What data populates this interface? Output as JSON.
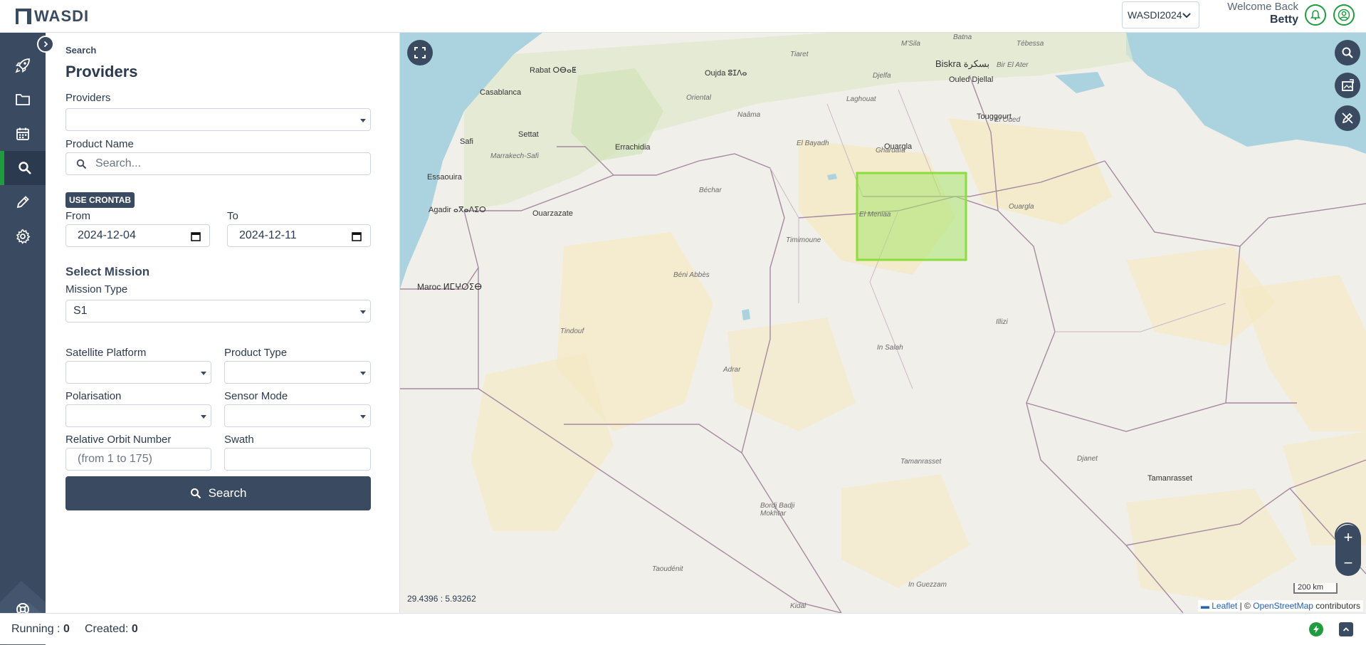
{
  "app": {
    "logo_text": "WASDI"
  },
  "header": {
    "workspace_label": "WASDI2024",
    "welcome_line": "Welcome Back",
    "user_name": "Betty"
  },
  "sidebar": {
    "items": [
      {
        "icon": "rocket-icon"
      },
      {
        "icon": "folder-icon"
      },
      {
        "icon": "calendar-icon"
      },
      {
        "icon": "search-icon",
        "active": true
      },
      {
        "icon": "pencil-icon"
      },
      {
        "icon": "gear-icon"
      }
    ],
    "help_icon": "lifebuoy-icon"
  },
  "form": {
    "breadcrumb": "Search",
    "title": "Providers",
    "providers_label": "Providers",
    "providers_value": "",
    "product_name_label": "Product Name",
    "product_name_placeholder": "Search...",
    "crontab_button": "USE CRONTAB",
    "from_label": "From",
    "from_value": "2024-12-04",
    "to_label": "To",
    "to_value": "2024-12-11",
    "mission_section": "Select Mission",
    "mission_type_label": "Mission Type",
    "mission_type_value": "S1",
    "satellite_platform_label": "Satellite Platform",
    "product_type_label": "Product Type",
    "polarisation_label": "Polarisation",
    "sensor_mode_label": "Sensor Mode",
    "relative_orbit_label": "Relative Orbit Number",
    "relative_orbit_placeholder": "(from 1 to 175)",
    "swath_label": "Swath",
    "search_button": "Search"
  },
  "map": {
    "coordinates": "29.4396 : 5.93262",
    "scale": "200 km",
    "attribution_leaflet": "Leaflet",
    "attribution_sep": "| ©",
    "attribution_osm": "OpenStreetMap",
    "attribution_tail": "contributors",
    "zoom_in": "+",
    "zoom_out": "−",
    "places": {
      "casablanca": "Casablanca",
      "rabat": "Rabat ⵔⴱⴰⵟ",
      "oujda": "Oujda ⵓⵊⴷⴰ",
      "biskra": "Biskra بسكرة",
      "ouargla_city": "Ouargla",
      "ouargla": "Ouargla",
      "ghardaia": "Ghardaïa",
      "el_bayadh": "El Bayadh",
      "laghouat": "Laghouat",
      "djelfa": "Djelfa",
      "el_oued": "El Oued",
      "touggourt": "Touggourt",
      "bechar": "Béchar",
      "timimoune": "Timimoune",
      "el_meniaa": "El Meniaa",
      "beni_abbes": "Béni Abbès",
      "tindouf": "Tindouf",
      "adrar": "Adrar",
      "in_salah": "In Salah",
      "illizi": "Illizi",
      "tamanrasset": "Tamanrasset",
      "tamanrasset_city": "Tamanrasset",
      "djanet": "Djanet",
      "bordj": "Bordj Badji Mokhtar",
      "taoudenit": "Taoudénit",
      "in_guezzam": "In Guezzam",
      "kidal": "Kidal",
      "maroc": "Maroc ⵍⵎⵖⵔⵉⴱ",
      "marrakech": "Marrakech-Safi",
      "agadir": "Agadir ⴰⴳⴰⴷⵉⵔ",
      "essaouira": "Essaouira",
      "errachidia": "Errachidia",
      "ouarzazate": "Ouarzazate",
      "settat": "Settat",
      "safi": "Safi",
      "tiaret": "Tiaret",
      "naama": "Naâma",
      "oriental": "Oriental",
      "tebessa": "Tébessa",
      "bir_el_ater": "Bir El Ater",
      "msila": "M'Sila",
      "batna": "Batna",
      "ouled_djellal": "Ouled Djellal"
    }
  },
  "status": {
    "running_label": "Running :",
    "running_value": "0",
    "created_label": "Created:",
    "created_value": "0"
  },
  "colors": {
    "primary": "#3a4a61",
    "accent_green": "#1f9d3e",
    "aoi_fill": "#a8e66b"
  }
}
